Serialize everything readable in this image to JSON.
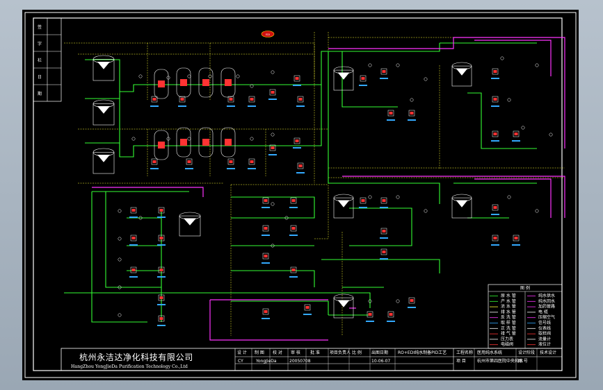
{
  "company": {
    "name_cn": "杭州永洁达净化科技有限公司",
    "name_en": "HangZhou YongJieDa Purification Technology Co.,Ltd"
  },
  "title_block": {
    "drawn_label": "设 计",
    "check_label": "制 图",
    "audit_label": "校 对",
    "approve_label": "审 核",
    "ratify_label": "批 准",
    "drawing_no_label": "项目负责人",
    "scale_label": "比 例",
    "date_label": "出图日期",
    "date_value": "10-06-07",
    "project_label": "工程名称",
    "project_value": "医用纯水系统",
    "stage_label": "设计阶段",
    "stage_value": "技术设计",
    "item_label": "项 目",
    "item_value": "杭州市第四医院中央纯水",
    "title_value": "RO+EDI纯水制备PID工艺",
    "row_values": [
      "CY",
      "YongJieDa",
      "20050708"
    ],
    "sheet_label": "图 号"
  },
  "legend": {
    "title": "图 例",
    "rows": [
      {
        "left": "原 水 管",
        "right": "纯水供水"
      },
      {
        "left": "产 水 管",
        "right": "纯水回水"
      },
      {
        "left": "浓 水 管",
        "right": "加药管路"
      },
      {
        "left": "排 水 管",
        "right": "电 缆"
      },
      {
        "left": "反 洗 管",
        "right": "压缩空气"
      },
      {
        "left": "取 样 管",
        "right": "信号线"
      },
      {
        "left": "正 洗 管",
        "right": "仪表线"
      },
      {
        "left": "排 气 管",
        "right": "取样阀"
      },
      {
        "left": "压力表",
        "right": "流量计"
      },
      {
        "left": "电磁阀",
        "right": "液位计"
      }
    ]
  },
  "side_stamp": [
    "签",
    "字",
    "栏",
    "日",
    "期"
  ],
  "badge": "EDI",
  "colors": {
    "main_pipe": "#33ff33",
    "pure_pipe": "#ff33ff",
    "dashed": "#ffff33",
    "valve": "#ff3333",
    "label": "#33aaff",
    "background": "#000000"
  }
}
